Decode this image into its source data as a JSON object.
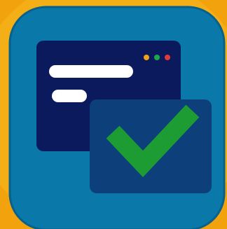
{
  "icon": {
    "name": "browser-window-checkmark-icon",
    "description_role": "app icon",
    "colors": {
      "background_outer": "#F2A20C",
      "background_inner": "#F7B81E",
      "tile": "#0A78A8",
      "tile_border": "#06618C",
      "window": "#0B1A5C",
      "text_bar": "#FFFFFF",
      "dot_1": "#F0A21A",
      "dot_2": "#1BA84A",
      "dot_3": "#E03A3A",
      "check_panel": "#0D3F7A",
      "check_mark": "#1E9C34"
    }
  }
}
